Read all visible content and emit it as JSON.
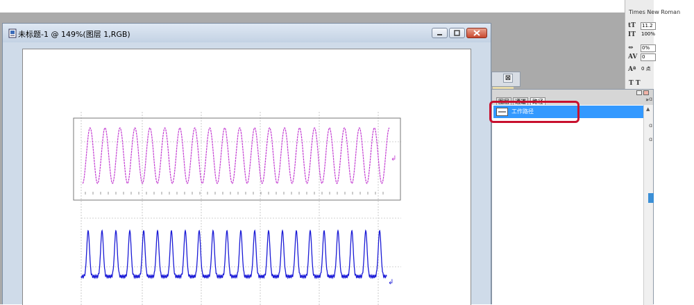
{
  "document": {
    "title": "未标题-1 @ 149%(图层 1,RGB)"
  },
  "back_panel": {
    "close_glyph": "⊠"
  },
  "paths_panel": {
    "tabs": [
      "图层",
      "通道",
      "路径"
    ],
    "active_tab": "路径",
    "menu_glyph": "»",
    "items": [
      {
        "label": "工作路径",
        "selected": true
      }
    ]
  },
  "character_panel": {
    "font_name": "Times New Roman",
    "size_value": "11.2",
    "vscale_value": "100%",
    "tracking_value": "0%",
    "kerning_value": "0",
    "baseline_value": "0 点",
    "style_glyphs": "T  T"
  },
  "colors": {
    "selection": "#3399ff",
    "highlight": "#c8102e",
    "wave_magenta": "#c23ad1",
    "wave_blue": "#1a1ad6"
  }
}
